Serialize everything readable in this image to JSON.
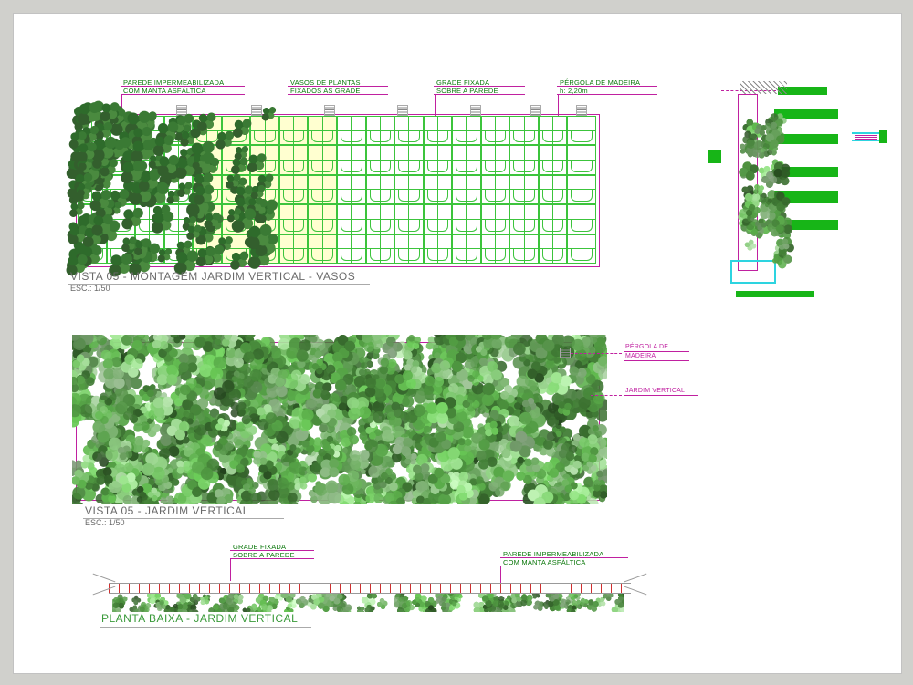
{
  "header": {
    "callouts": [
      {
        "line1": "PAREDE IMPERMEABILIZADA",
        "line2": "COM MANTA ASFÁLTICA"
      },
      {
        "line1": "VASOS DE PLANTAS",
        "line2": "FIXADOS AS GRADE"
      },
      {
        "line1": "GRADE FIXADA",
        "line2": "SOBRE A PAREDE"
      },
      {
        "line1": "PÉRGOLA DE MADEIRA",
        "line2": "h: 2,20m"
      }
    ]
  },
  "view1": {
    "title": "VISTA 05 - MONTAGEM JARDIM VERTICAL - VASOS",
    "scale": "ESC.: 1/50"
  },
  "view2": {
    "title": "VISTA 05 -  JARDIM VERTICAL",
    "scale": "ESC.: 1/50",
    "callouts": [
      {
        "line1": "PÉRGOLA DE",
        "line2": "MADEIRA"
      },
      {
        "line1": "JARDIM VERTICAL"
      }
    ]
  },
  "plan": {
    "title": "PLANTA BAIXA - JARDIM VERTICAL",
    "callouts": [
      {
        "line1": "GRADE FIXADA",
        "line2": "SOBRE A PAREDE"
      },
      {
        "line1": "PAREDE IMPERMEABILIZADA",
        "line2": "COM MANTA ASFÁLTICA"
      }
    ]
  },
  "grid": {
    "cols": 18,
    "rows": 5
  },
  "colors": {
    "magenta": "#c020a0",
    "green": "#17b517",
    "leaf": "#2e6b2b",
    "cyan": "#2dd4e0"
  }
}
